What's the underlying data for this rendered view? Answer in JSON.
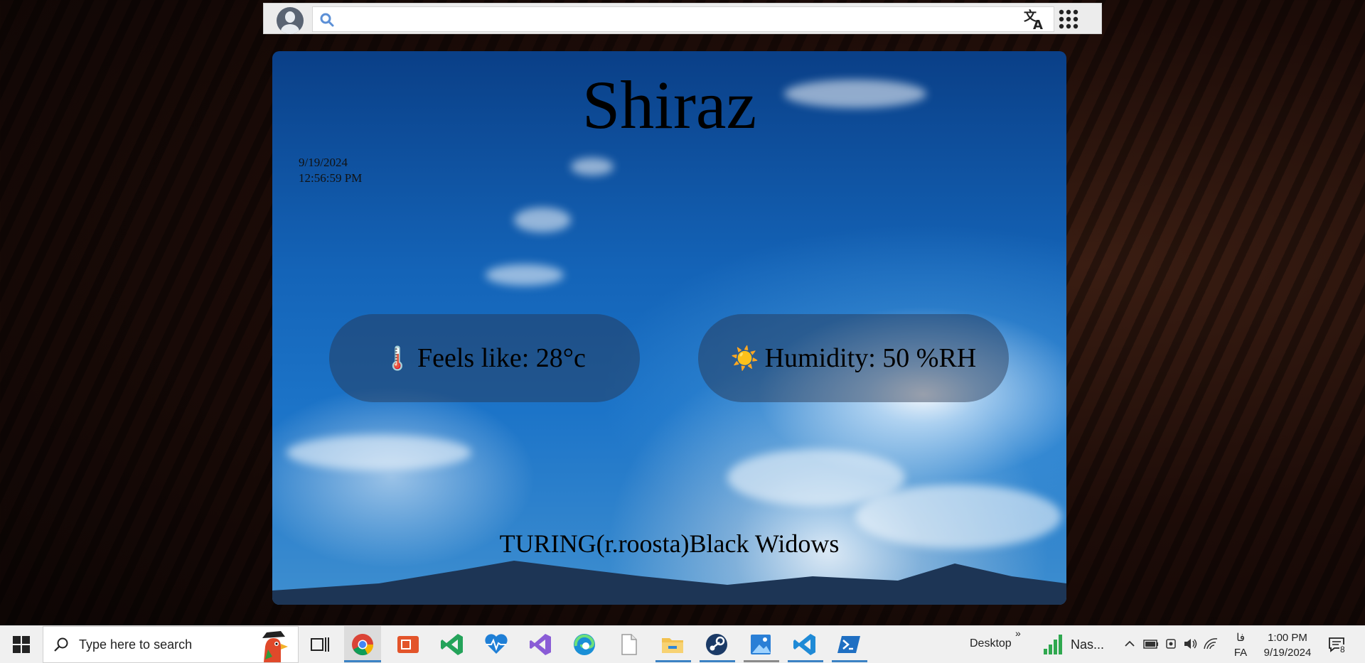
{
  "topbar": {
    "search_placeholder": "",
    "avatar_icon": "user-avatar-icon",
    "translate_icon": "translate-icon",
    "apps_icon": "apps-grid-icon"
  },
  "weather": {
    "city": "Shiraz",
    "date": "9/19/2024",
    "time": "12:56:59 PM",
    "feels_emoji": "🌡️",
    "feels_label": "Feels like: 28°c",
    "humidity_emoji": "☀️",
    "humidity_label": "Humidity: 50 %RH",
    "footer": "TURING(r.roosta)Black Widows"
  },
  "taskbar": {
    "search_placeholder": "Type here to search",
    "desktop_label": "Desktop",
    "chevron": "»",
    "nas_label": "Nas...",
    "ime_top": "فا",
    "ime_bottom": "FA",
    "time": "1:00 PM",
    "date": "9/19/2024",
    "notification_count": "8",
    "apps": [
      "task-view",
      "chrome",
      "presentation-app",
      "visual-studio-code-green",
      "heart-rate-app",
      "visual-studio",
      "edge",
      "file",
      "file-explorer",
      "steam",
      "photos",
      "vscode",
      "powershell"
    ]
  }
}
